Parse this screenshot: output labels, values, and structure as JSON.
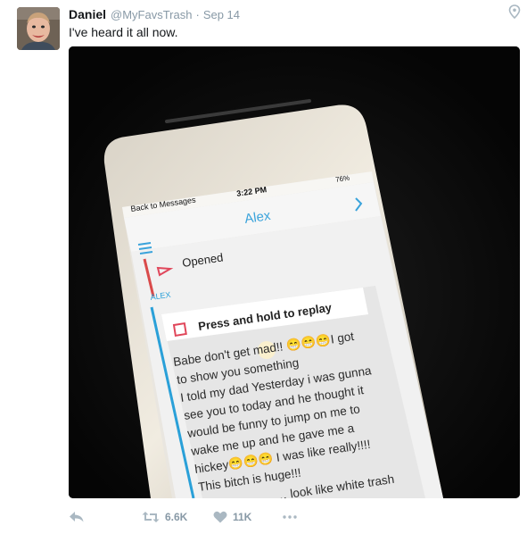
{
  "tweet": {
    "display_name": "Daniel",
    "handle": "@MyFavsTrash",
    "separator": "·",
    "date": "Sep 14",
    "text": "I've heard it all now.",
    "location_icon": "location-pin-icon"
  },
  "phone_screen": {
    "back_label": "Back to Messages",
    "time": "3:22 PM",
    "battery": "76%",
    "contact_name": "Alex",
    "opened_label": "Opened",
    "sender_label": "ALEX",
    "replay_label": "Press and hold to replay",
    "message_lines": [
      "Babe don't get mad!! 😁😁😁I got",
      "to show you something",
      "I told my dad Yesterday i was gunna",
      "see you to today and he thought it",
      "would be funny to jump on me to",
      "wake me up and he gave me a",
      "hickey😁😁😁 I was like really!!!!",
      "This bitch is huge!!!",
      "… look like white trash"
    ]
  },
  "actions": {
    "reply_icon": "reply-icon",
    "retweet_icon": "retweet-icon",
    "retweet_count": "6.6K",
    "like_icon": "heart-icon",
    "like_count": "11K",
    "more_icon": "more-icon",
    "icon_color": "#8899a6"
  }
}
